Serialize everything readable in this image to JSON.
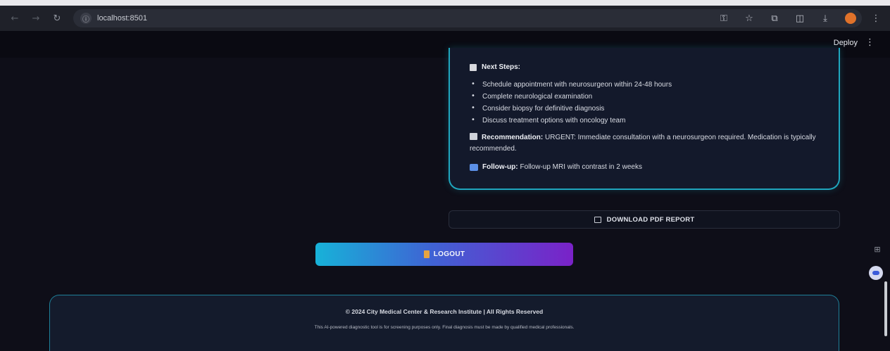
{
  "browser": {
    "url": "localhost:8501",
    "nav_icons": [
      "back-arrow-icon",
      "forward-arrow-icon",
      "reload-icon"
    ],
    "toolbar_icons": [
      "password-key-icon",
      "star-icon",
      "extensions-icon",
      "sidebar-icon",
      "download-icon",
      "profile-icon",
      "kebab-menu-icon"
    ]
  },
  "app_header": {
    "deploy_label": "Deploy",
    "menu_label": "⋮"
  },
  "report": {
    "next_steps_title": "Next Steps:",
    "steps": [
      "Schedule appointment with neurosurgeon within 24-48 hours",
      "Complete neurological examination",
      "Consider biopsy for definitive diagnosis",
      "Discuss treatment options with oncology team"
    ],
    "recommendation_label": "Recommendation:",
    "recommendation_text": "URGENT: Immediate consultation with a neurosurgeon required. Medication is typically recommended.",
    "followup_label": "Follow-up:",
    "followup_text": "Follow-up MRI with contrast in 2 weeks"
  },
  "download_button": {
    "label": "DOWNLOAD PDF REPORT"
  },
  "logout_button": {
    "label": "LOGOUT"
  },
  "footer": {
    "copyright": "© 2024 City Medical Center & Research Institute | All Rights Reserved",
    "disclaimer": "This AI-powered diagnostic tool is for screening purposes only. Final diagnosis must be made by qualified medical professionals."
  },
  "colors": {
    "background": "#0e0e18",
    "card_border": "#1fa5bd",
    "logout_gradient_start": "#17b2d8",
    "logout_gradient_end": "#7a22c8"
  }
}
